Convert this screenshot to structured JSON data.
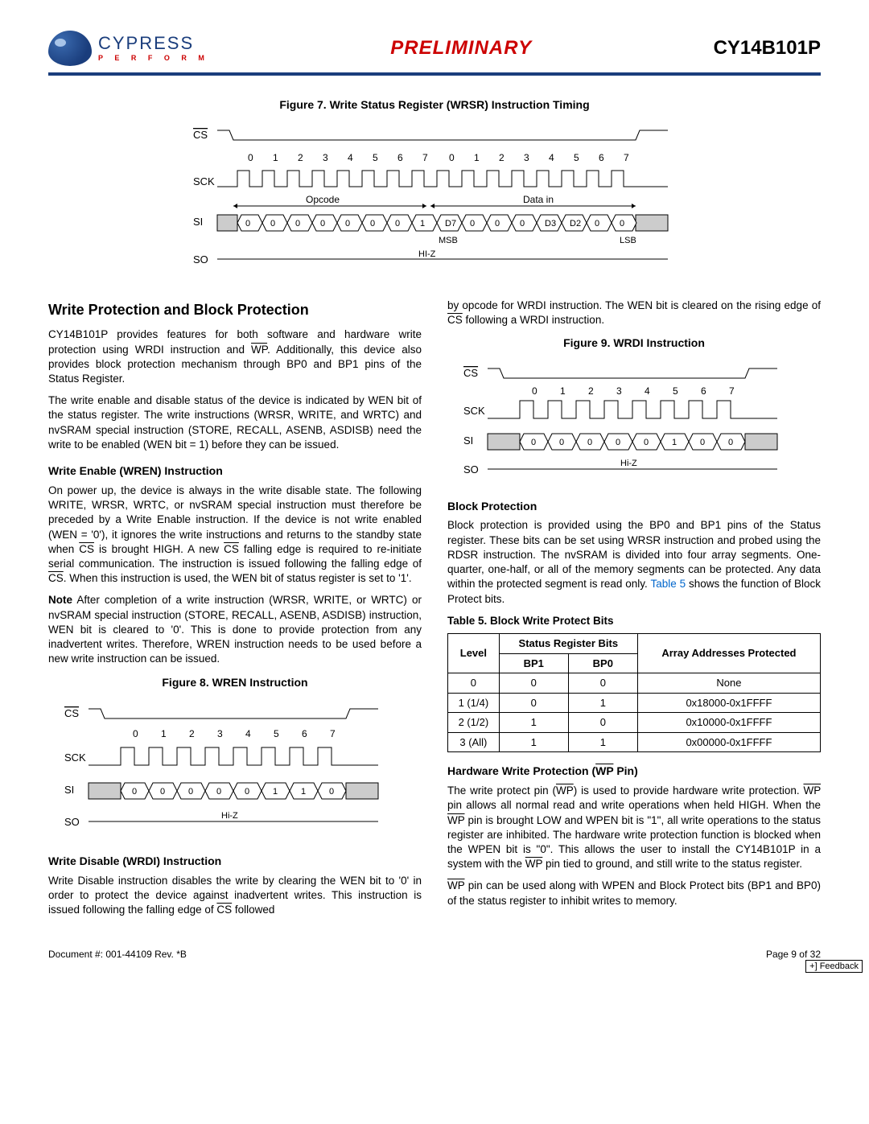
{
  "header": {
    "company": "CYPRESS",
    "tagline": "P E R F O R M",
    "preliminary": "PRELIMINARY",
    "part": "CY14B101P"
  },
  "fig7": {
    "caption": "Figure 7.  Write Status Register (WRSR) Instruction Timing",
    "cs": "CS",
    "sck": "SCK",
    "si": "SI",
    "so": "SO",
    "opcode": "Opcode",
    "datain": "Data in",
    "msb": "MSB",
    "lsb": "LSB",
    "hiz": "HI-Z",
    "ticks1": [
      "0",
      "1",
      "2",
      "3",
      "4",
      "5",
      "6",
      "7"
    ],
    "ticks2": [
      "0",
      "1",
      "2",
      "3",
      "4",
      "5",
      "6",
      "7"
    ],
    "si_vals": [
      "0",
      "0",
      "0",
      "0",
      "0",
      "0",
      "0",
      "1",
      "D7",
      "0",
      "0",
      "0",
      "D3",
      "D2",
      "0",
      "0"
    ]
  },
  "leftcol": {
    "h2": "Write Protection and Block Protection",
    "p1a": "CY14B101P provides features for both software and hardware write protection using WRDI instruction and ",
    "p1b": ". Additionally, this device also provides block protection mechanism through BP0 and BP1 pins of the Status Register.",
    "p2": "The write enable and disable status of the device is indicated by WEN bit of the status register. The write instructions (WRSR, WRITE, and WRTC) and nvSRAM special instruction (STORE, RECALL, ASENB, ASDISB) need the write to be enabled (WEN bit = 1) before they can be issued.",
    "h3a": "Write Enable (WREN) Instruction",
    "p3a": "On power up, the device is always in the write disable state. The following WRITE, WRSR, WRTC, or nvSRAM special instruction must therefore be preceded by a Write Enable instruction. If the device is not write enabled (WEN = '0'), it ignores the write instructions and returns to the standby state when ",
    "p3b": " is brought HIGH. A new ",
    "p3c": " falling edge is required to re-initiate serial communication. The instruction is issued following the falling edge of ",
    "p3d": ". When this instruction is used, the WEN bit of status register is set to '1'.",
    "note": "Note",
    "p4": " After completion of a write instruction (WRSR, WRITE, or WRTC) or nvSRAM special instruction (STORE, RECALL, ASENB, ASDISB) instruction, WEN bit is cleared to '0'. This is done to provide protection from any inadvertent writes. Therefore, WREN instruction needs to be used before a new write instruction can be issued.",
    "fig8cap": "Figure 8.  WREN Instruction",
    "h3b": "Write Disable (WRDI) Instruction",
    "p5a": "Write Disable instruction disables the write by clearing the WEN bit to '0' in order to protect the device against inadvertent writes. This instruction is issued following the falling edge of ",
    "p5b": " followed"
  },
  "fig8": {
    "cs": "CS",
    "sck": "SCK",
    "si": "SI",
    "so": "SO",
    "hiz": "Hi-Z",
    "ticks": [
      "0",
      "1",
      "2",
      "3",
      "4",
      "5",
      "6",
      "7"
    ],
    "si_vals": [
      "0",
      "0",
      "0",
      "0",
      "0",
      "1",
      "1",
      "0"
    ]
  },
  "rightcol": {
    "p1a": "by opcode for WRDI instruction. The WEN bit is cleared on the rising edge of ",
    "p1b": " following a WRDI instruction.",
    "fig9cap": "Figure 9.  WRDI Instruction",
    "h3a": "Block Protection",
    "p2a": "Block protection is provided using the BP0 and BP1 pins of the Status register. These bits can be set using WRSR instruction and probed using the RDSR instruction. The nvSRAM is divided into four array segments. One-quarter, one-half, or all of the memory segments can be protected. Any data within the protected segment is read only. ",
    "tbl5ref": "Table 5",
    "p2b": " shows the function of Block Protect bits.",
    "tbl5cap": "Table 5.  Block Write Protect Bits",
    "h3b": "Hardware Write Protection (",
    "h3b2": " Pin)",
    "p3a": "The write protect pin (",
    "p3b": ") is used to provide hardware write protection. ",
    "p3c": " pin allows all normal read and write operations when held HIGH. When the ",
    "p3d": " pin is brought LOW and WPEN bit is \"1\", all write operations to the status register are inhibited. The hardware write protection function is blocked when the WPEN bit is \"0\". This allows the user to install the CY14B101P in a system with the ",
    "p3e": " pin tied to ground, and still write to the status register.",
    "p4a": "",
    "p4b": " pin can be used along with WPEN and Block Protect bits (BP1 and BP0) of the status register to inhibit writes to memory."
  },
  "fig9": {
    "cs": "CS",
    "sck": "SCK",
    "si": "SI",
    "so": "SO",
    "hiz": "Hi-Z",
    "ticks": [
      "0",
      "1",
      "2",
      "3",
      "4",
      "5",
      "6",
      "7"
    ],
    "si_vals": [
      "0",
      "0",
      "0",
      "0",
      "0",
      "1",
      "0",
      "0"
    ]
  },
  "table5": {
    "th_level": "Level",
    "th_srb": "Status Register Bits",
    "th_aap": "Array Addresses Protected",
    "th_bp1": "BP1",
    "th_bp0": "BP0",
    "rows": [
      {
        "level": "0",
        "bp1": "0",
        "bp0": "0",
        "addr": "None"
      },
      {
        "level": "1 (1/4)",
        "bp1": "0",
        "bp0": "1",
        "addr": "0x18000-0x1FFFF"
      },
      {
        "level": "2 (1/2)",
        "bp1": "1",
        "bp0": "0",
        "addr": "0x10000-0x1FFFF"
      },
      {
        "level": "3 (All)",
        "bp1": "1",
        "bp0": "1",
        "addr": "0x00000-0x1FFFF"
      }
    ]
  },
  "footer": {
    "doc": "Document #: 001-44109 Rev. *B",
    "page": "Page 9 of 32",
    "feedback": "+] Feedback"
  },
  "labels": {
    "wp": "WP",
    "cs": "CS"
  }
}
